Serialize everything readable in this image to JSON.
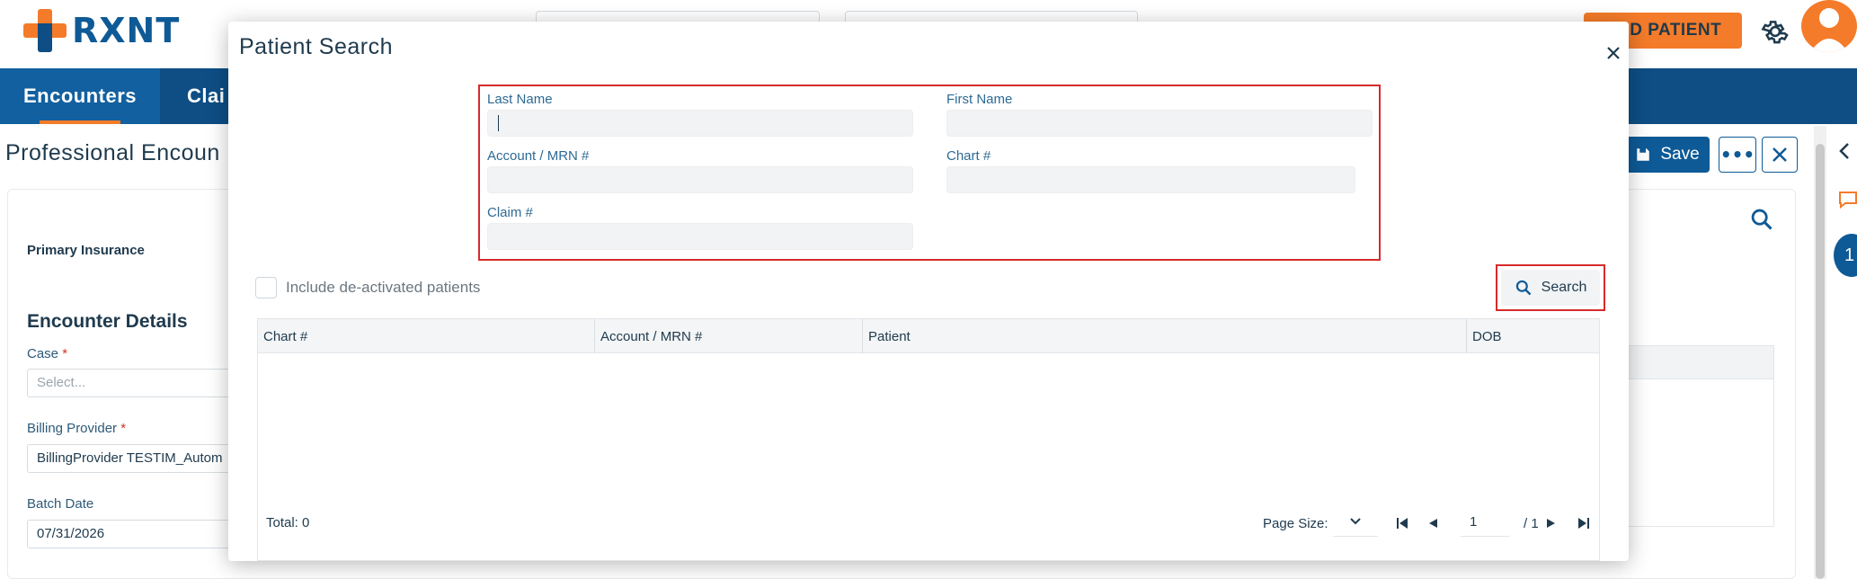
{
  "app": {
    "logo_text": "RXNT",
    "add_patient_label": "ADD PATIENT",
    "nav": {
      "tabs": [
        {
          "label": "Encounters"
        },
        {
          "label": "Clai"
        }
      ]
    },
    "page_title": "Professional Encoun",
    "toolbar": {
      "save_label": "Save"
    },
    "form": {
      "primary_insurance_label": "Primary Insurance",
      "encounter_details_title": "Encounter Details",
      "case_label": "Case",
      "case_placeholder": "Select...",
      "billing_provider_label": "Billing Provider",
      "billing_provider_value": "BillingProvider TESTIM_Autom",
      "batch_date_label": "Batch Date",
      "batch_date_value": "07/31/2026",
      "required_marker": "*"
    },
    "side_badge": "1"
  },
  "modal": {
    "title": "Patient Search",
    "fields": {
      "last_name": {
        "label": "Last Name",
        "value": ""
      },
      "first_name": {
        "label": "First Name",
        "value": ""
      },
      "account_mrn": {
        "label": "Account / MRN #",
        "value": ""
      },
      "chart": {
        "label": "Chart #",
        "value": ""
      },
      "claim": {
        "label": "Claim #",
        "value": ""
      }
    },
    "include_deactivated_label": "Include de-activated patients",
    "search_button_label": "Search",
    "grid": {
      "columns": [
        "Chart #",
        "Account / MRN #",
        "Patient",
        "DOB"
      ],
      "rows": []
    },
    "total_label": "Total: 0",
    "pager": {
      "page_size_label": "Page Size:",
      "page_size_value": "",
      "current_page": "1",
      "total_pages": "/ 1"
    }
  },
  "colors": {
    "brand_blue": "#0e4e85",
    "brand_orange": "#f47b2a",
    "highlight_red": "#d62a2a"
  }
}
